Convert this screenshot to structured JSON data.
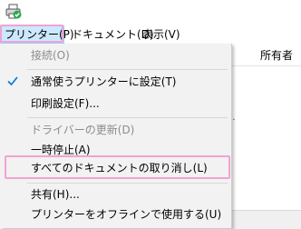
{
  "menubar": {
    "printer_label": "プリンター(P)",
    "document_label": "ドキュメント(D)",
    "view_label": "表示(V)"
  },
  "background": {
    "owner_column": "所有者",
    "dots": "..."
  },
  "dropdown": {
    "items": [
      {
        "label": "接続(O)",
        "enabled": false
      },
      {
        "label": "通常使うプリンターに設定(T)",
        "enabled": true,
        "checked": true
      },
      {
        "label": "印刷設定(F)...",
        "enabled": true
      },
      {
        "label": "ドライバーの更新(D)",
        "enabled": false
      },
      {
        "label": "一時停止(A)",
        "enabled": true
      },
      {
        "label": "すべてのドキュメントの取り消し(L)",
        "enabled": true,
        "highlighted": true
      },
      {
        "label": "共有(H)...",
        "enabled": true
      },
      {
        "label": "プリンターをオフラインで使用する(U)",
        "enabled": true
      }
    ]
  },
  "colors": {
    "menu_selected_bg": "#cce8ff",
    "menu_selected_border": "#99d1ff",
    "annotation_pink": "#f2a3d0",
    "dropdown_bg": "#f2f2f2",
    "disabled_text": "#8c8c8c",
    "check_blue": "#0078d7"
  },
  "icons": {
    "app": "printer-icon",
    "check": "check-icon"
  }
}
